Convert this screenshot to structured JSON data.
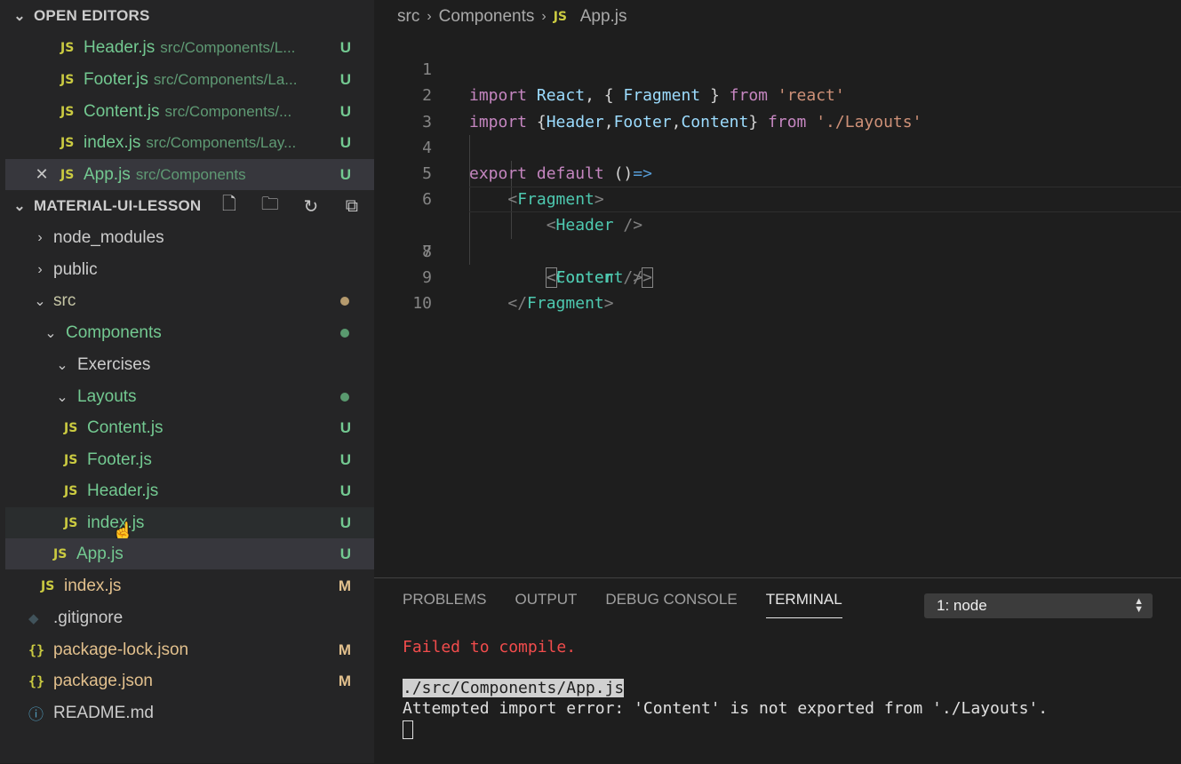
{
  "sidebar": {
    "open_editors_title": "OPEN EDITORS",
    "open_editors": [
      {
        "name": "Header.js",
        "path": "src/Components/L...",
        "status": "U"
      },
      {
        "name": "Footer.js",
        "path": "src/Components/La...",
        "status": "U"
      },
      {
        "name": "Content.js",
        "path": "src/Components/...",
        "status": "U"
      },
      {
        "name": "index.js",
        "path": "src/Components/Lay...",
        "status": "U"
      },
      {
        "name": "App.js",
        "path": "src/Components",
        "status": "U"
      }
    ],
    "project_title": "MATERIAL-UI-LESSON",
    "tree": {
      "node_modules": "node_modules",
      "public": "public",
      "src": "src",
      "components": "Components",
      "exercises": "Exercises",
      "layouts": "Layouts",
      "content_js": {
        "name": "Content.js",
        "status": "U"
      },
      "footer_js": {
        "name": "Footer.js",
        "status": "U"
      },
      "header_js": {
        "name": "Header.js",
        "status": "U"
      },
      "layouts_index_js": {
        "name": "index.js",
        "status": "U"
      },
      "app_js": {
        "name": "App.js",
        "status": "U"
      },
      "src_index_js": {
        "name": "index.js",
        "status": "M"
      },
      "gitignore": ".gitignore",
      "package_lock": {
        "name": "package-lock.json",
        "status": "M"
      },
      "package_json": {
        "name": "package.json",
        "status": "M"
      },
      "readme": "README.md"
    },
    "js_icon_label": "JS",
    "json_icon_label": "{}"
  },
  "editor": {
    "breadcrumb": [
      "src",
      "Components",
      "App.js"
    ],
    "line_numbers": [
      "1",
      "2",
      "3",
      "4",
      "5",
      "6",
      "7",
      "8",
      "9",
      "10"
    ],
    "code": {
      "l1": [
        "import",
        "React",
        ", {",
        "Fragment",
        "}",
        "from",
        "'react'"
      ],
      "l2": [
        "import",
        "{",
        "Header",
        ",",
        "Footer",
        ",",
        "Content",
        "}",
        "from",
        "'./Layouts'"
      ],
      "l4": [
        "export",
        "default",
        "()",
        "=>"
      ],
      "l5": [
        "<",
        "Fragment",
        ">"
      ],
      "l6": [
        "<",
        "Header",
        " />"
      ],
      "l7": [
        "<",
        "Content",
        " /",
        ">"
      ],
      "l8": [
        "<",
        "Footer",
        " />"
      ],
      "l9": [
        "</",
        "Fragment",
        ">"
      ]
    }
  },
  "panel": {
    "tabs": [
      "PROBLEMS",
      "OUTPUT",
      "DEBUG CONSOLE",
      "TERMINAL"
    ],
    "active_tab": "TERMINAL",
    "terminal_select": "1: node",
    "terminal_lines": {
      "error": "Failed to compile.",
      "file": "./src/Components/App.js",
      "message": "Attempted import error: 'Content' is not exported from './Layouts'."
    }
  },
  "colors": {
    "untracked_green": "#73c991",
    "modified_yellow": "#e2c08d",
    "error_red": "#f14c4c",
    "js_icon": "#cbcb41"
  }
}
